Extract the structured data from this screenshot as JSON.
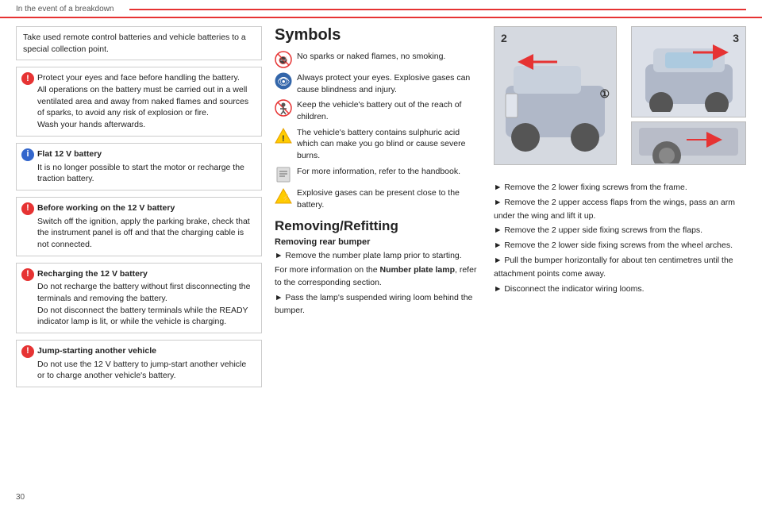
{
  "header": {
    "title": "In the event of a breakdown",
    "page_number": "30"
  },
  "left_col": {
    "notice": {
      "text": "Take used remote control batteries and vehicle batteries to a special collection point."
    },
    "warning1": {
      "text": "Protect your eyes and face before handling the battery.\nAll operations on the battery must be carried out in a well ventilated area and away from naked flames and sources of sparks, to avoid any risk of explosion or fire.\nWash your hands afterwards."
    },
    "info_box": {
      "title": "Flat 12 V battery",
      "text": "It is no longer possible to start the motor or recharge the traction battery."
    },
    "warning2": {
      "title": "Before working on the 12 V battery",
      "text": "Switch off the ignition, apply the parking brake, check that the instrument panel is off and that the charging cable is not connected."
    },
    "warning3": {
      "title": "Recharging the 12 V battery",
      "text": "Do not recharge the battery without first disconnecting the terminals and removing the battery.\nDo not disconnect the battery terminals while the READY indicator lamp is lit, or while the vehicle is charging."
    },
    "warning4": {
      "title": "Jump-starting another vehicle",
      "text": "Do not use the 12 V battery to jump-start another vehicle or to charge another vehicle's battery."
    }
  },
  "middle_col": {
    "symbols_title": "Symbols",
    "symbols": [
      {
        "id": "no-fire",
        "text": "No sparks or naked flames, no smoking."
      },
      {
        "id": "eye",
        "text": "Always protect your eyes. Explosive gases can cause blindness and injury."
      },
      {
        "id": "child",
        "text": "Keep the vehicle's battery out of the reach of children."
      },
      {
        "id": "acid",
        "text": "The vehicle's battery contains sulphuric acid which can make you go blind or cause severe burns."
      },
      {
        "id": "handbook",
        "text": "For more information, refer to the handbook."
      },
      {
        "id": "gas",
        "text": "Explosive gases can be present close to the battery."
      }
    ],
    "refitting_title": "Removing/Refitting",
    "removing_sub": "Removing rear bumper",
    "removing_steps": [
      "Remove the number plate lamp prior to starting.",
      "Pass the lamp's suspended wiring loom behind the bumper."
    ],
    "number_plate_text": "For more information on the Number plate lamp, refer to the corresponding section."
  },
  "right_col": {
    "image_numbers": [
      "2",
      "3",
      "1"
    ],
    "instructions": [
      "Remove the 2 lower fixing screws from the frame.",
      "Remove the 2 upper access flaps from the wings, pass an arm under the wing and lift it up.",
      "Remove the 2 upper side fixing screws from the flaps.",
      "Remove the 2 lower side fixing screws from the wheel arches.",
      "Pull the bumper horizontally for about ten centimetres until the attachment points come away.",
      "Disconnect the indicator wiring looms."
    ]
  }
}
